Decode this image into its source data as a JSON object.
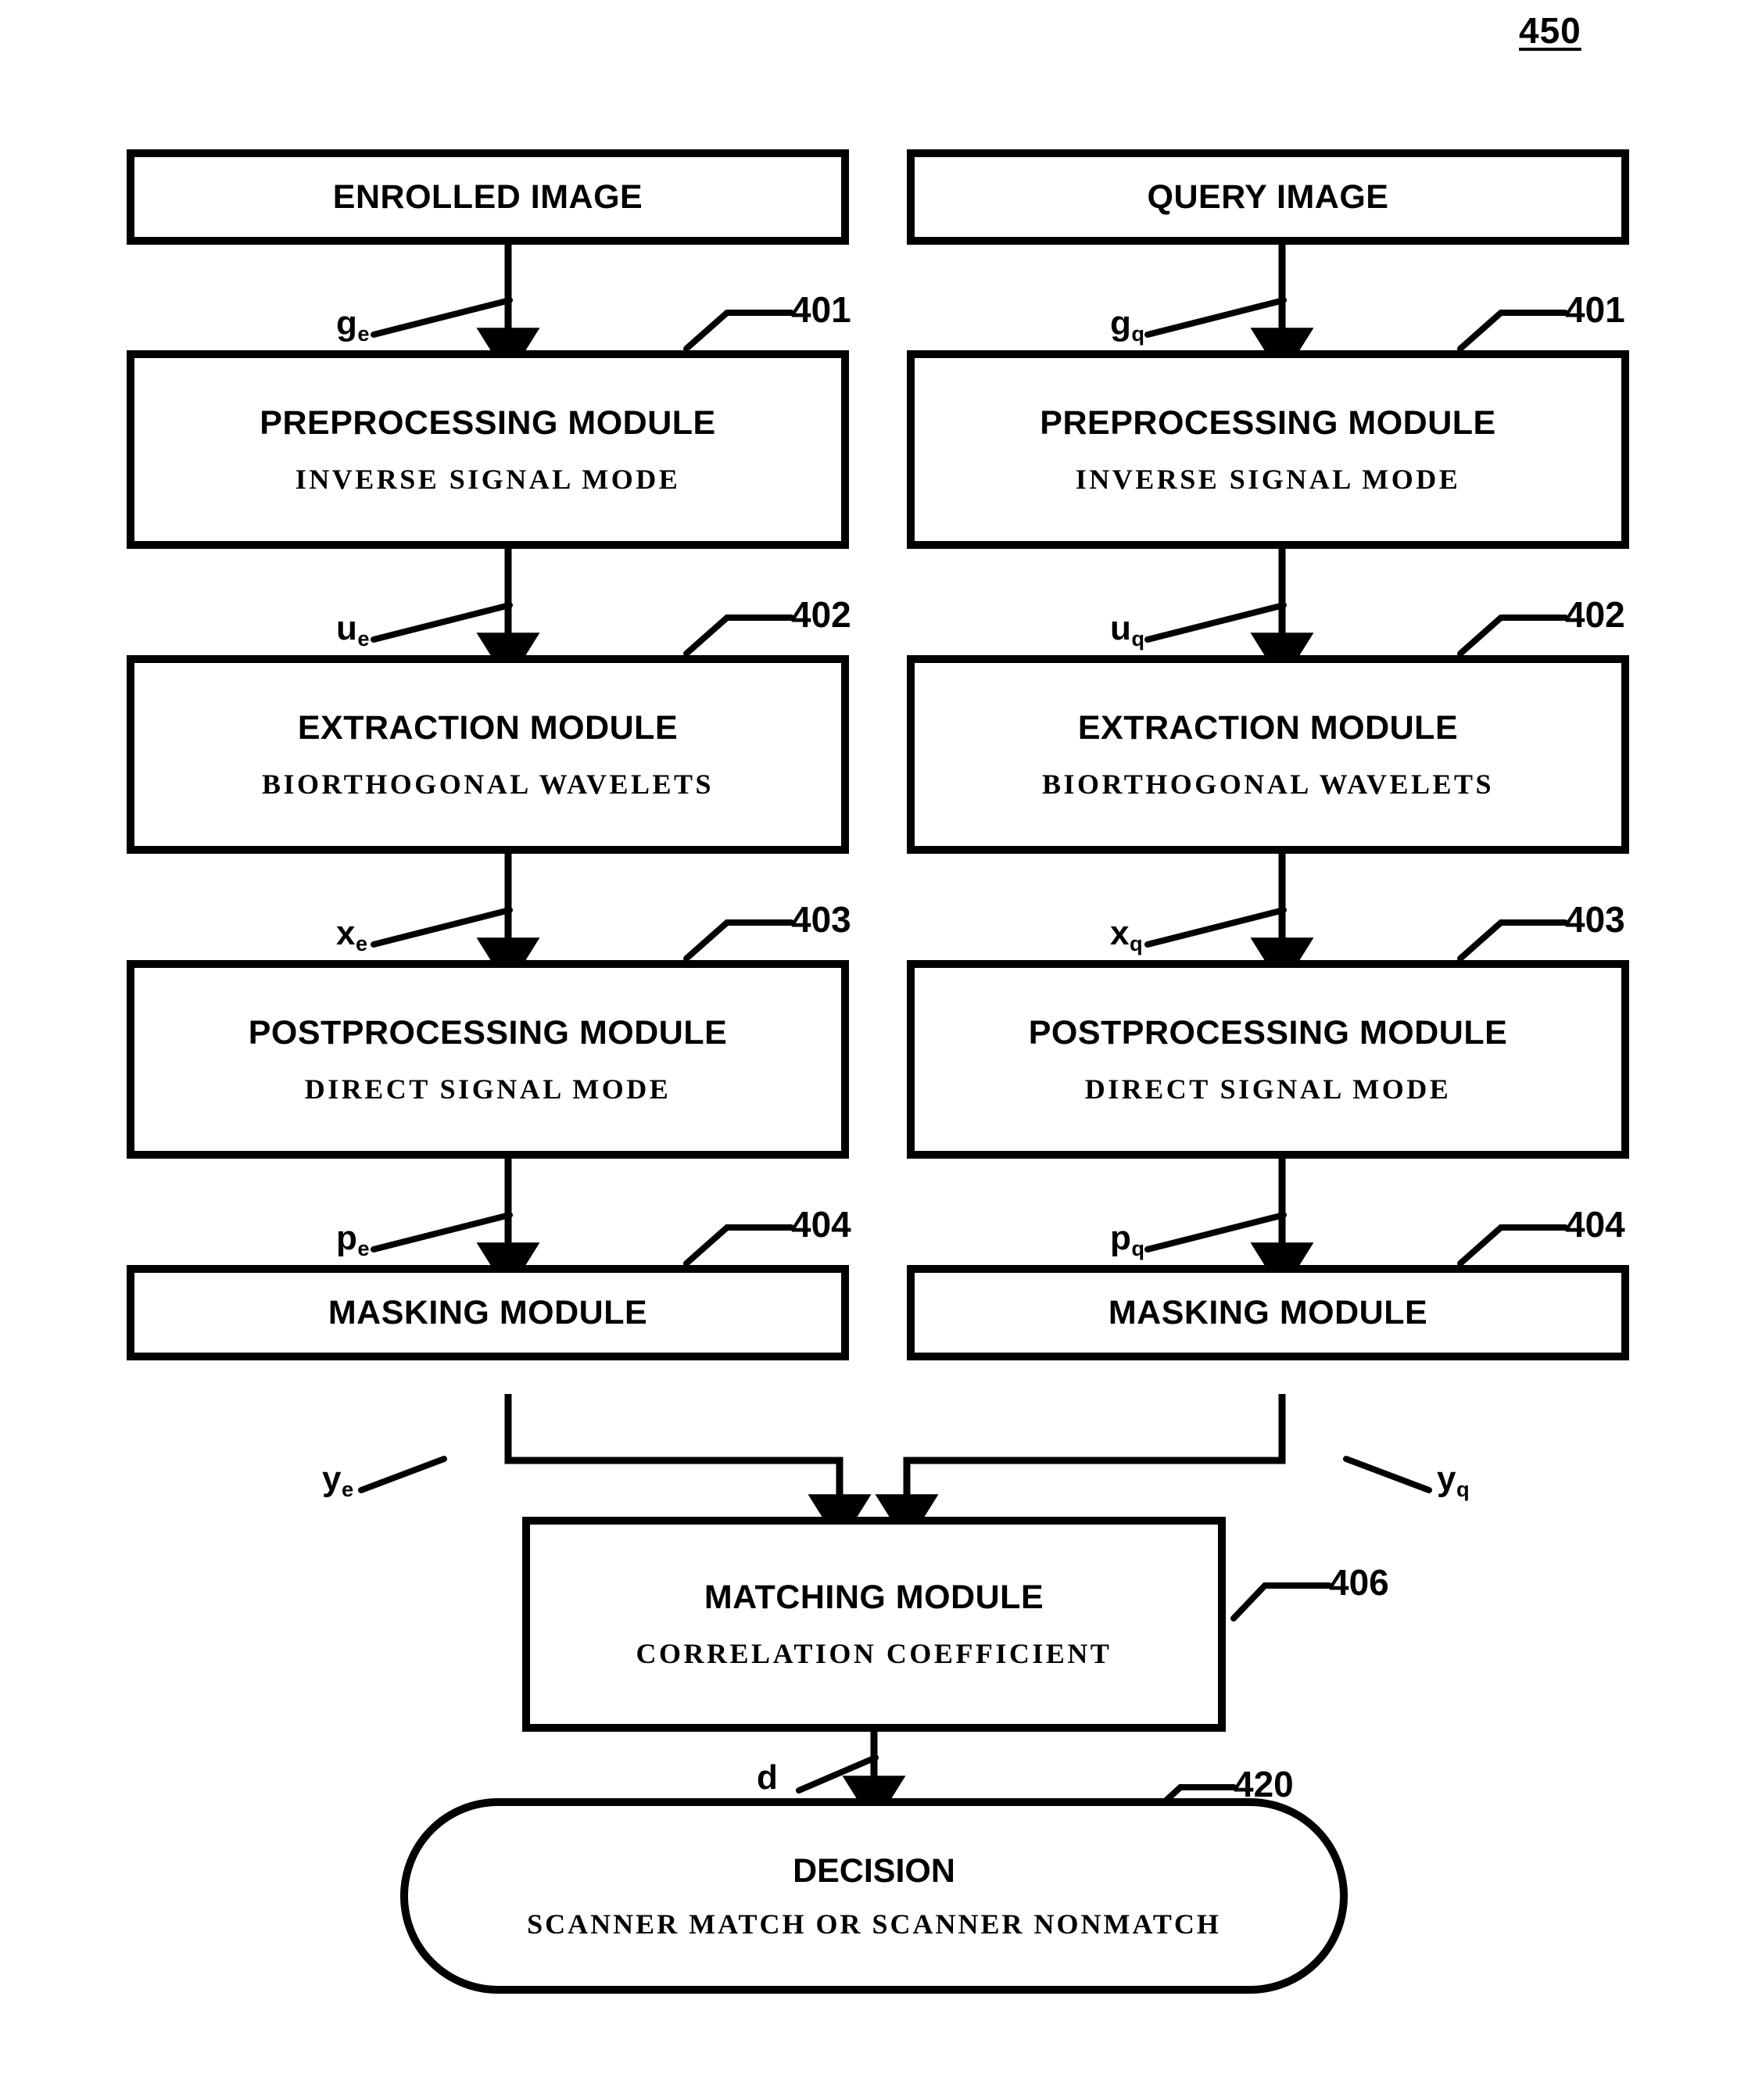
{
  "figure": {
    "number": "450"
  },
  "nodes": {
    "enrolled_image": {
      "title": "ENROLLED IMAGE",
      "subtitle": ""
    },
    "query_image": {
      "title": "QUERY IMAGE",
      "subtitle": ""
    },
    "preprocessing_left": {
      "title": "PREPROCESSING MODULE",
      "subtitle": "INVERSE SIGNAL MODE"
    },
    "preprocessing_right": {
      "title": "PREPROCESSING MODULE",
      "subtitle": "INVERSE SIGNAL MODE"
    },
    "extraction_left": {
      "title": "EXTRACTION MODULE",
      "subtitle": "BIORTHOGONAL WAVELETS"
    },
    "extraction_right": {
      "title": "EXTRACTION MODULE",
      "subtitle": "BIORTHOGONAL WAVELETS"
    },
    "postprocessing_left": {
      "title": "POSTPROCESSING MODULE",
      "subtitle": "DIRECT SIGNAL MODE"
    },
    "postprocessing_right": {
      "title": "POSTPROCESSING MODULE",
      "subtitle": "DIRECT SIGNAL MODE"
    },
    "masking_left": {
      "title": "MASKING MODULE",
      "subtitle": ""
    },
    "masking_right": {
      "title": "MASKING MODULE",
      "subtitle": ""
    },
    "matching": {
      "title": "MATCHING MODULE",
      "subtitle": "CORRELATION COEFFICIENT"
    },
    "decision": {
      "title": "DECISION",
      "subtitle": "SCANNER MATCH OR SCANNER NONMATCH"
    }
  },
  "signal_labels": {
    "g_e": {
      "base": "g",
      "sub": "e"
    },
    "g_q": {
      "base": "g",
      "sub": "q"
    },
    "u_e": {
      "base": "u",
      "sub": "e"
    },
    "u_q": {
      "base": "u",
      "sub": "q"
    },
    "x_e": {
      "base": "x",
      "sub": "e"
    },
    "x_q": {
      "base": "x",
      "sub": "q"
    },
    "p_e": {
      "base": "p",
      "sub": "e"
    },
    "p_q": {
      "base": "p",
      "sub": "q"
    },
    "y_e": {
      "base": "y",
      "sub": "e"
    },
    "y_q": {
      "base": "y",
      "sub": "q"
    },
    "d": {
      "base": "d",
      "sub": ""
    }
  },
  "reference_numerals": {
    "preprocessing_left": "401",
    "preprocessing_right": "401",
    "extraction_left": "402",
    "extraction_right": "402",
    "postprocessing_left": "403",
    "postprocessing_right": "403",
    "masking_left": "404",
    "masking_right": "404",
    "matching": "406",
    "decision": "420"
  },
  "colors": {
    "stroke": "#000000",
    "background": "#ffffff",
    "text": "#000000"
  }
}
